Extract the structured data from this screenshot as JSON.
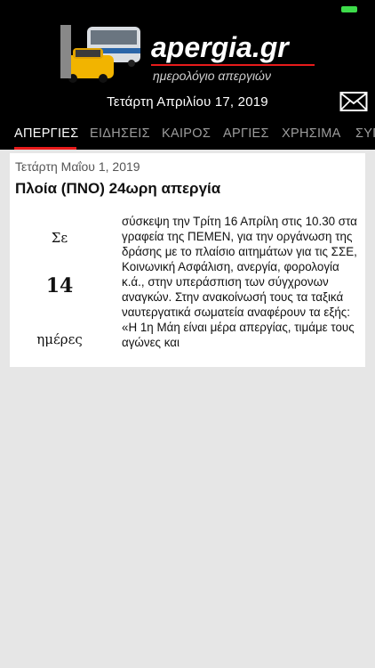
{
  "header": {
    "logo_title": "apergia.gr",
    "logo_subtitle": "ημερολόγιο απεργιών",
    "current_date": "Τετάρτη Απριλίου 17, 2019",
    "mail_icon": "envelope-icon"
  },
  "tabs": [
    {
      "label": "ΑΠΕΡΓΙΕΣ",
      "active": true
    },
    {
      "label": "ΕΙΔΗΣΕΙΣ",
      "active": false
    },
    {
      "label": "ΚΑΙΡΟΣ",
      "active": false
    },
    {
      "label": "ΑΡΓΙΕΣ",
      "active": false
    },
    {
      "label": "ΧΡΗΣΙΜΑ",
      "active": false
    },
    {
      "label": "ΣΥΓ",
      "active": false
    }
  ],
  "strike": {
    "date": "Τετάρτη Μαΐου 1, 2019",
    "title": "Πλοία (ΠΝΟ) 24ωρη απεργία",
    "countdown_prefix": "Σε",
    "countdown_value": "14",
    "countdown_unit": "ημέρες",
    "body": "σύσκεψη την Τρίτη 16 Απρίλη στις 10.30 στα γραφεία της ΠΕΜΕΝ, για την οργάνωση της δράσης με το πλαίσιο αιτημάτων για τις ΣΣΕ, Κοινωνική Ασφάλιση, ανεργία, φορολογία κ.ά., στην υπεράσπιση των σύγχρονων αναγκών. Στην ανακοίνωσή τους τα ταξικά ναυτεργατικά σωματεία αναφέρουν τα εξής: «Η 1η Μάη είναι μέρα απεργίας, τιμάμε τους αγώνες και"
  },
  "colors": {
    "accent": "#e81b1b",
    "header_bg": "#000000",
    "content_bg": "#e6e6e6",
    "battery": "#3ddc4a"
  }
}
